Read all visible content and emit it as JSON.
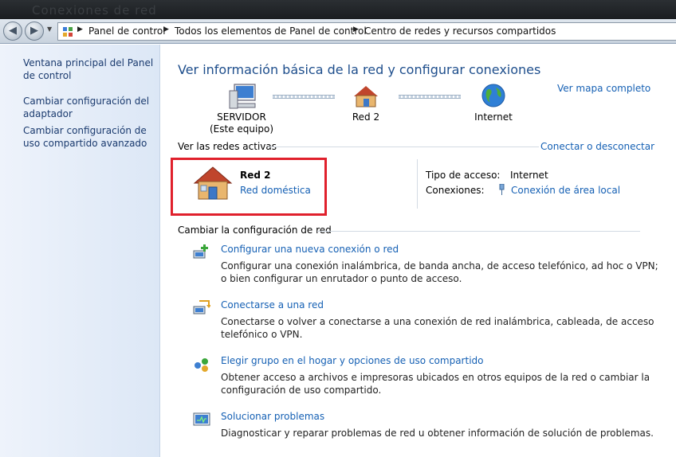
{
  "window": {
    "ghost_title": "Conexiones de red"
  },
  "nav": {
    "back_label": "◀",
    "forward_label": "▶",
    "breadcrumbs": [
      {
        "label": "Panel de control"
      },
      {
        "label": "Todos los elementos de Panel de control"
      },
      {
        "label": "Centro de redes y recursos compartidos"
      }
    ]
  },
  "sidebar": {
    "items": [
      {
        "label": "Ventana principal del Panel de control"
      },
      {
        "label": "Cambiar configuración del adaptador"
      },
      {
        "label": "Cambiar configuración de uso compartido avanzado"
      }
    ]
  },
  "main": {
    "title": "Ver información básica de la red y configurar conexiones",
    "map_link": "Ver mapa completo",
    "map": {
      "computer_name": "SERVIDOR",
      "computer_sub": "(Este equipo)",
      "network_name": "Red  2",
      "internet_label": "Internet"
    },
    "active_networks": {
      "heading": "Ver las redes activas",
      "connect_link": "Conectar o desconectar",
      "network_name": "Red  2",
      "network_type": "Red doméstica",
      "access_type_label": "Tipo de acceso:",
      "access_type_value": "Internet",
      "connections_label": "Conexiones:",
      "connections_value": "Conexión de área local"
    },
    "change_settings": {
      "heading": "Cambiar la configuración de red",
      "tasks": [
        {
          "icon": "new-connection-icon",
          "title": "Configurar una nueva conexión o red",
          "description": "Configurar una conexión inalámbrica, de banda ancha, de acceso telefónico, ad hoc o VPN; o bien configurar un enrutador o punto de acceso."
        },
        {
          "icon": "connect-network-icon",
          "title": "Conectarse a una red",
          "description": "Conectarse o volver a conectarse a una conexión de red inalámbrica, cableada, de acceso telefónico o VPN."
        },
        {
          "icon": "homegroup-icon",
          "title": "Elegir grupo en el hogar y opciones de uso compartido",
          "description": "Obtener acceso a archivos e impresoras ubicados en otros equipos de la red o cambiar la configuración de uso compartido."
        },
        {
          "icon": "troubleshoot-icon",
          "title": "Solucionar problemas",
          "description": "Diagnosticar y reparar problemas de red u obtener información de solución de problemas."
        }
      ]
    }
  },
  "colors": {
    "title_blue": "#1e4e8c",
    "link_blue": "#1560b4",
    "highlight_red": "#e0202c"
  }
}
